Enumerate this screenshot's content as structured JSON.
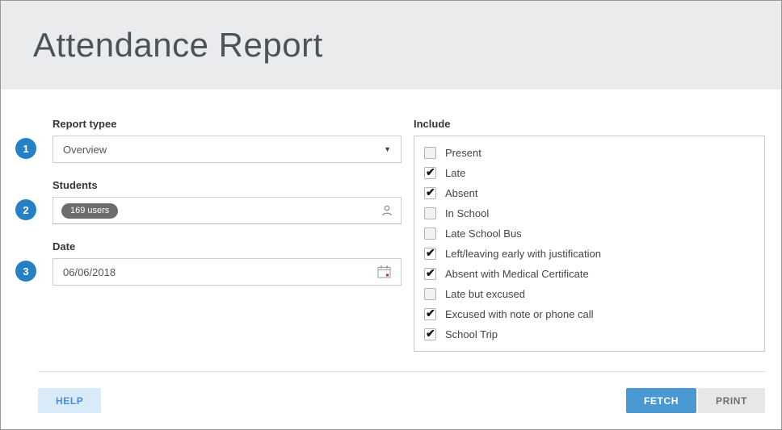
{
  "page": {
    "title": "Attendance Report"
  },
  "form": {
    "report_type": {
      "step": "1",
      "label": "Report typee",
      "value": "Overview"
    },
    "students": {
      "step": "2",
      "label": "Students",
      "chip": "169 users"
    },
    "date": {
      "step": "3",
      "label": "Date",
      "value": "06/06/2018"
    }
  },
  "include": {
    "label": "Include",
    "options": [
      {
        "label": "Present",
        "checked": false
      },
      {
        "label": "Late",
        "checked": true
      },
      {
        "label": "Absent",
        "checked": true
      },
      {
        "label": "In School",
        "checked": false
      },
      {
        "label": "Late School Bus",
        "checked": false
      },
      {
        "label": "Left/leaving early with justification",
        "checked": true
      },
      {
        "label": "Absent with Medical Certificate",
        "checked": true
      },
      {
        "label": "Late but excused",
        "checked": false
      },
      {
        "label": "Excused with note or phone call",
        "checked": true
      },
      {
        "label": "School Trip",
        "checked": true
      }
    ]
  },
  "footer": {
    "help_label": "HELP",
    "fetch_label": "FETCH",
    "print_label": "PRINT"
  },
  "icons": {
    "students": "person-icon",
    "date": "calendar-icon",
    "report_type": "dropdown-arrow-icon"
  },
  "colors": {
    "header_band": "#e9ebed",
    "step_badge_blue": "#2580c6",
    "chip_gray": "#6d6d6d",
    "fetch_blue": "#4a99d3",
    "help_bg": "#d9eaf8",
    "help_text": "#4a90d2"
  }
}
